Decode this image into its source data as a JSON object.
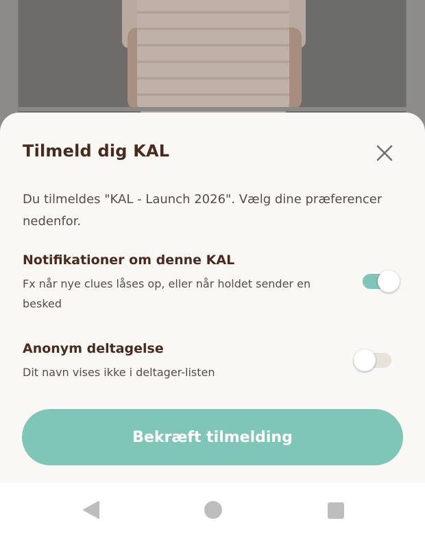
{
  "sheet": {
    "title": "Tilmeld dig KAL",
    "intro": "Du tilmeldes \"KAL - Launch 2026\". Vælg dine præferencer nedenfor.",
    "options": [
      {
        "title": "Notifikationer om denne KAL",
        "description": "Fx når nye clues låses op, eller når holdet sender en besked",
        "enabled": true
      },
      {
        "title": "Anonym deltagelse",
        "description": "Dit navn vises ikke i deltager-listen",
        "enabled": false
      }
    ],
    "confirm_label": "Bekræft tilmelding"
  },
  "icons": {
    "close": "close-icon",
    "nav_back": "back-triangle-icon",
    "nav_home": "home-circle-icon",
    "nav_recent": "recent-square-icon"
  },
  "colors": {
    "accent": "#7fc5b8",
    "title_brown": "#4a2a1c",
    "sheet_bg": "#faf8f5",
    "toggle_off_track": "#e9e2da"
  }
}
